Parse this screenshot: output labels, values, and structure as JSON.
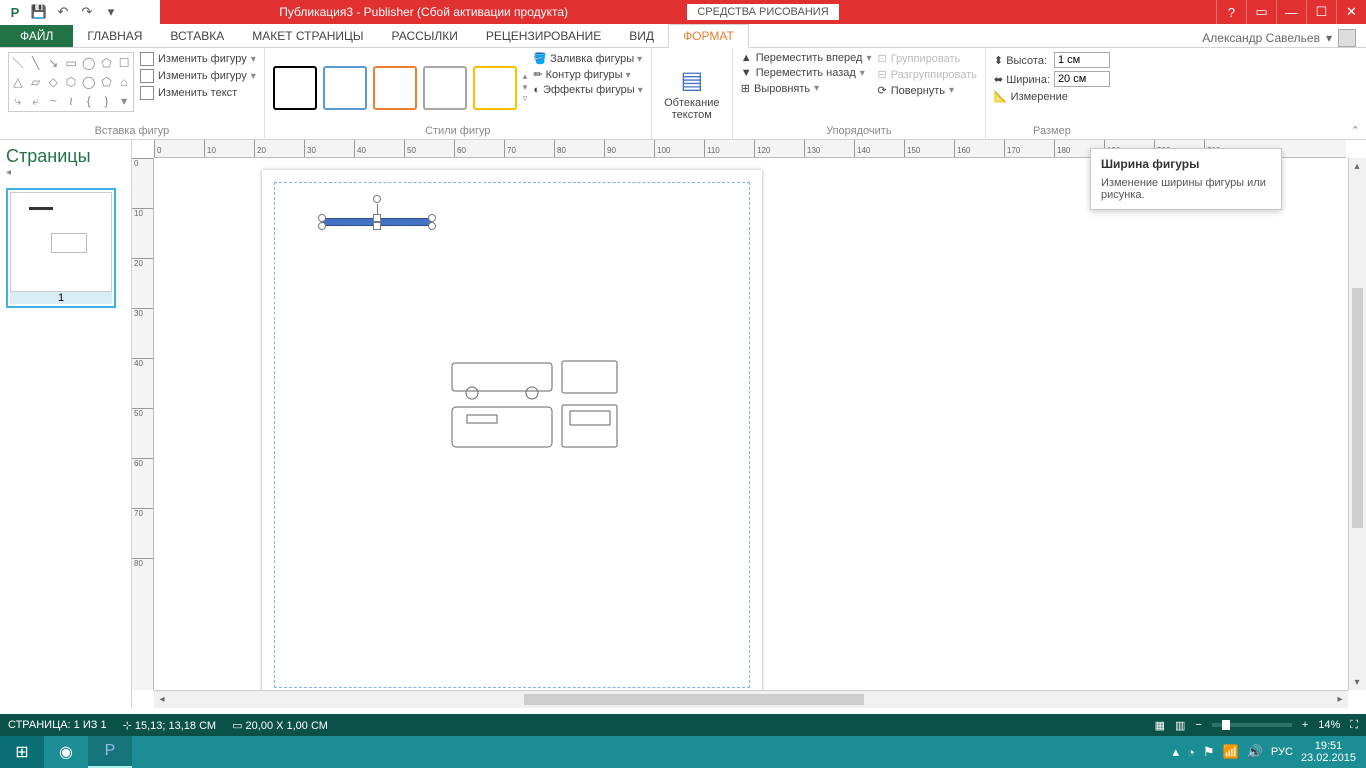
{
  "title": "Публикация3 -  Publisher (Сбой активации продукта)",
  "contextual_tab": "СРЕДСТВА РИСОВАНИЯ",
  "user": "Александр Савельев",
  "tabs": {
    "file": "ФАЙЛ",
    "home": "ГЛАВНАЯ",
    "insert": "ВСТАВКА",
    "pagelayout": "МАКЕТ СТРАНИЦЫ",
    "mailings": "РАССЫЛКИ",
    "review": "РЕЦЕНЗИРОВАНИЕ",
    "view": "ВИД",
    "format": "ФОРМАТ"
  },
  "ribbon": {
    "shapes": {
      "edit_shape": "Изменить фигуру",
      "change_shape": "Изменить фигуру",
      "edit_text": "Изменить текст",
      "group": "Вставка фигур"
    },
    "styles": {
      "fill": "Заливка фигуры",
      "outline": "Контур фигуры",
      "effects": "Эффекты фигуры",
      "group": "Стили фигур"
    },
    "wrap": {
      "label": "Обтекание текстом",
      "group": ""
    },
    "arrange": {
      "bring_forward": "Переместить вперед",
      "send_backward": "Переместить назад",
      "align": "Выровнять",
      "group_cmd": "Группировать",
      "ungroup": "Разгруппировать",
      "rotate": "Повернуть",
      "group": "Упорядочить"
    },
    "size": {
      "height_label": "Высота:",
      "width_label": "Ширина:",
      "height_value": "1 см",
      "width_value": "20 см",
      "measure": "Измерение",
      "group": "Размер"
    }
  },
  "tooltip": {
    "title": "Ширина фигуры",
    "body": "Изменение ширины фигуры или рисунка."
  },
  "pages": {
    "title": "Страницы",
    "num": "1"
  },
  "ruler_h": [
    "0",
    "10",
    "20",
    "30",
    "40",
    "50",
    "60",
    "70",
    "80",
    "90",
    "100",
    "110",
    "120",
    "130",
    "140",
    "150",
    "160",
    "170",
    "180",
    "190",
    "200",
    "210"
  ],
  "ruler_v": [
    "0",
    "10",
    "20",
    "30",
    "40",
    "50",
    "60",
    "70",
    "80"
  ],
  "status": {
    "page": "СТРАНИЦА: 1 ИЗ 1",
    "pos": "15,13; 13,18 СМ",
    "size": "20,00 X  1,00 СМ",
    "zoom": "14%"
  },
  "taskbar": {
    "lang": "РУС",
    "time": "19:51",
    "date": "23.02.2015"
  }
}
